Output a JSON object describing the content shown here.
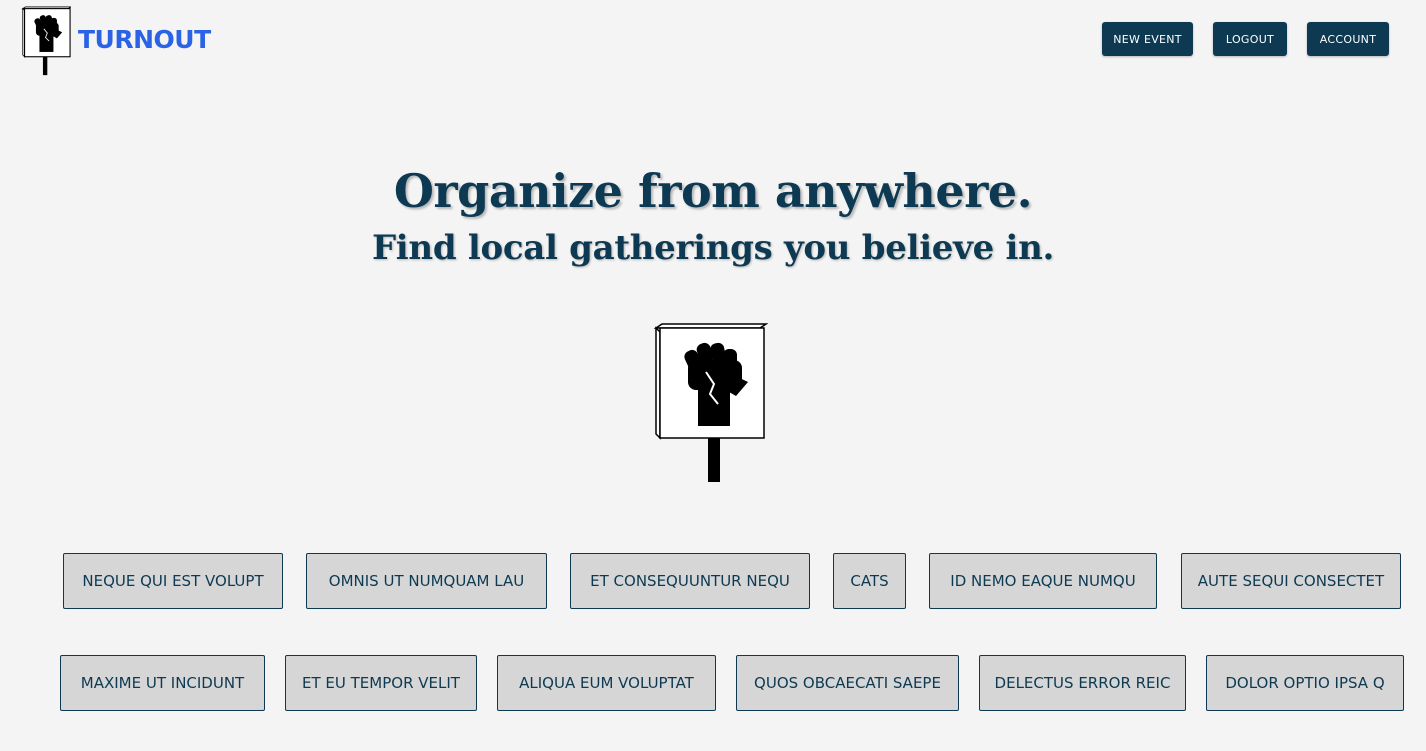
{
  "header": {
    "brand": "TURNOUT",
    "nav": {
      "new_event": "NEW EVENT",
      "logout": "LOGOUT",
      "account": "ACCOUNT"
    }
  },
  "hero": {
    "title": "Organize from anywhere.",
    "subtitle": "Find local gatherings you believe in."
  },
  "icons": {
    "logo": "raised-fist-sign-icon",
    "hero": "raised-fist-sign-icon"
  },
  "colors": {
    "brand_blue": "#2a63e6",
    "navy": "#0d3a52",
    "tag_background": "#d6d6d6",
    "page_background": "#f4f4f4"
  },
  "tags": {
    "row1": [
      "NEQUE QUI EST VOLUPT",
      "OMNIS UT NUMQUAM LAU",
      "ET CONSEQUUNTUR NEQU",
      "CATS",
      "ID NEMO EAQUE NUMQU",
      "AUTE SEQUI CONSECTET"
    ],
    "row2": [
      "MAXIME UT INCIDUNT",
      "ET EU TEMPOR VELIT",
      "ALIQUA EUM VOLUPTAT",
      "QUOS OBCAECATI SAEPE",
      "DELECTUS ERROR REIC",
      "DOLOR OPTIO IPSA Q"
    ]
  }
}
